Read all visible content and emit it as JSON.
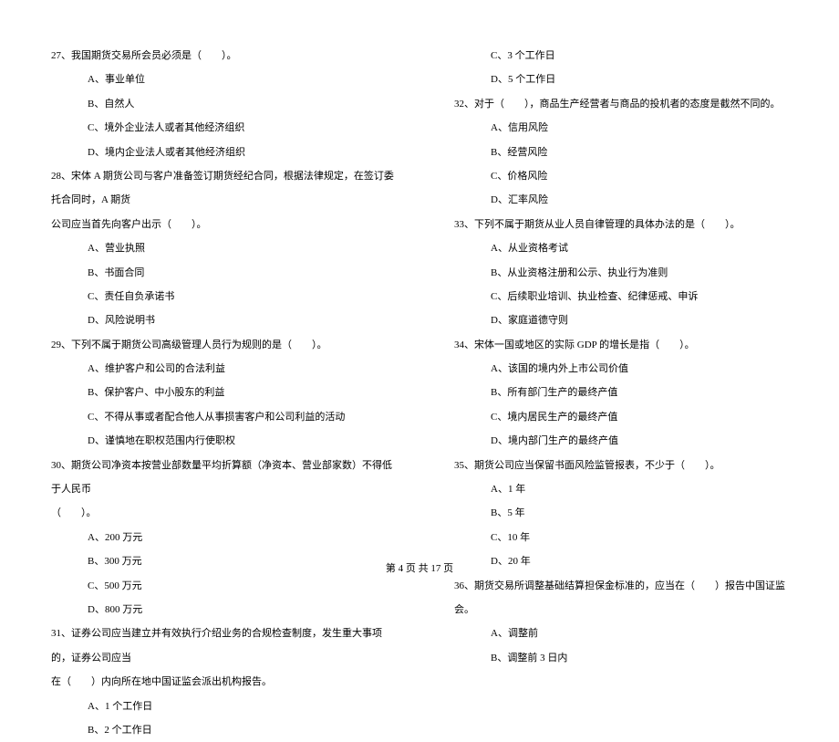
{
  "left_column": [
    {
      "type": "q",
      "text": "27、我国期货交易所会员必须是（　　）。"
    },
    {
      "type": "opt",
      "text": "A、事业单位"
    },
    {
      "type": "opt",
      "text": "B、自然人"
    },
    {
      "type": "opt",
      "text": "C、境外企业法人或者其他经济组织"
    },
    {
      "type": "opt",
      "text": "D、境内企业法人或者其他经济组织"
    },
    {
      "type": "q",
      "text": "28、宋体 A 期货公司与客户准备签订期货经纪合同，根据法律规定，在签订委托合同时，A 期货"
    },
    {
      "type": "cont",
      "text": "公司应当首先向客户出示（　　）。"
    },
    {
      "type": "opt",
      "text": "A、营业执照"
    },
    {
      "type": "opt",
      "text": "B、书面合同"
    },
    {
      "type": "opt",
      "text": "C、责任自负承诺书"
    },
    {
      "type": "opt",
      "text": "D、风险说明书"
    },
    {
      "type": "q",
      "text": "29、下列不属于期货公司高级管理人员行为规则的是（　　）。"
    },
    {
      "type": "opt",
      "text": "A、维护客户和公司的合法利益"
    },
    {
      "type": "opt",
      "text": "B、保护客户、中小股东的利益"
    },
    {
      "type": "opt",
      "text": "C、不得从事或者配合他人从事损害客户和公司利益的活动"
    },
    {
      "type": "opt",
      "text": "D、谨慎地在职权范围内行使职权"
    },
    {
      "type": "q",
      "text": "30、期货公司净资本按营业部数量平均折算额（净资本、营业部家数）不得低于人民币"
    },
    {
      "type": "cont",
      "text": "（　　）。"
    },
    {
      "type": "opt",
      "text": "A、200 万元"
    },
    {
      "type": "opt",
      "text": "B、300 万元"
    },
    {
      "type": "opt",
      "text": "C、500 万元"
    },
    {
      "type": "opt",
      "text": "D、800 万元"
    },
    {
      "type": "q",
      "text": "31、证券公司应当建立并有效执行介绍业务的合规检查制度，发生重大事项的，证券公司应当"
    },
    {
      "type": "cont",
      "text": "在（　　）内向所在地中国证监会派出机构报告。"
    },
    {
      "type": "opt",
      "text": "A、1 个工作日"
    },
    {
      "type": "opt",
      "text": "B、2 个工作日"
    }
  ],
  "right_column": [
    {
      "type": "opt",
      "text": "C、3 个工作日"
    },
    {
      "type": "opt",
      "text": "D、5 个工作日"
    },
    {
      "type": "q",
      "text": "32、对于（　　），商品生产经营者与商品的投机者的态度是截然不同的。"
    },
    {
      "type": "opt",
      "text": "A、信用风险"
    },
    {
      "type": "opt",
      "text": "B、经营风险"
    },
    {
      "type": "opt",
      "text": "C、价格风险"
    },
    {
      "type": "opt",
      "text": "D、汇率风险"
    },
    {
      "type": "q",
      "text": "33、下列不属于期货从业人员自律管理的具体办法的是（　　）。"
    },
    {
      "type": "opt",
      "text": "A、从业资格考试"
    },
    {
      "type": "opt",
      "text": "B、从业资格注册和公示、执业行为准则"
    },
    {
      "type": "opt",
      "text": "C、后续职业培训、执业检查、纪律惩戒、申诉"
    },
    {
      "type": "opt",
      "text": "D、家庭道德守则"
    },
    {
      "type": "q",
      "text": "34、宋体一国或地区的实际 GDP 的增长是指（　　）。"
    },
    {
      "type": "opt",
      "text": "A、该国的境内外上市公司价值"
    },
    {
      "type": "opt",
      "text": "B、所有部门生产的最终产值"
    },
    {
      "type": "opt",
      "text": "C、境内居民生产的最终产值"
    },
    {
      "type": "opt",
      "text": "D、境内部门生产的最终产值"
    },
    {
      "type": "q",
      "text": "35、期货公司应当保留书面风险监管报表，不少于（　　）。"
    },
    {
      "type": "opt",
      "text": "A、1 年"
    },
    {
      "type": "opt",
      "text": "B、5 年"
    },
    {
      "type": "opt",
      "text": "C、10 年"
    },
    {
      "type": "opt",
      "text": "D、20 年"
    },
    {
      "type": "q",
      "text": "36、期货交易所调整基础结算担保金标准的，应当在（　　）报告中国证监会。"
    },
    {
      "type": "opt",
      "text": "A、调整前"
    },
    {
      "type": "opt",
      "text": "B、调整前 3 日内"
    }
  ],
  "footer": "第 4 页 共 17 页"
}
